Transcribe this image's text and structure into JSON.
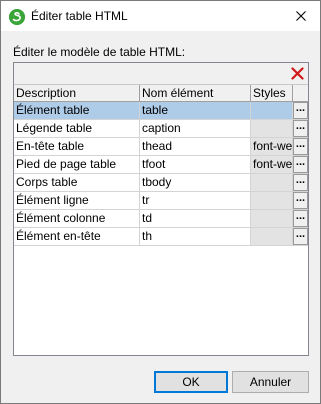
{
  "window": {
    "title": "Éditer table HTML"
  },
  "dialog": {
    "prompt": "Éditer le modèle de table HTML:"
  },
  "table": {
    "columns": [
      "Description",
      "Nom élément",
      "Styles"
    ],
    "rows": [
      {
        "description": "Élément table",
        "element": "table",
        "styles": "",
        "selected": true
      },
      {
        "description": "Légende table",
        "element": "caption",
        "styles": ""
      },
      {
        "description": "En-tête table",
        "element": "thead",
        "styles": "font-we"
      },
      {
        "description": "Pied de page table",
        "element": "tfoot",
        "styles": "font-we"
      },
      {
        "description": "Corps table",
        "element": "tbody",
        "styles": ""
      },
      {
        "description": "Élément ligne",
        "element": "tr",
        "styles": ""
      },
      {
        "description": "Élément colonne",
        "element": "td",
        "styles": ""
      },
      {
        "description": "Élément en-tête",
        "element": "th",
        "styles": ""
      }
    ],
    "ellipsis": "..."
  },
  "buttons": {
    "ok": "OK",
    "cancel": "Annuler"
  },
  "colors": {
    "accent": "#0078d7",
    "selection": "#aecbe8",
    "delete": "#d01818",
    "app_icon": "#3aa63a"
  },
  "icons": {
    "app": "xmlspy-logo-icon",
    "close": "close-icon",
    "delete": "delete-x-icon"
  }
}
